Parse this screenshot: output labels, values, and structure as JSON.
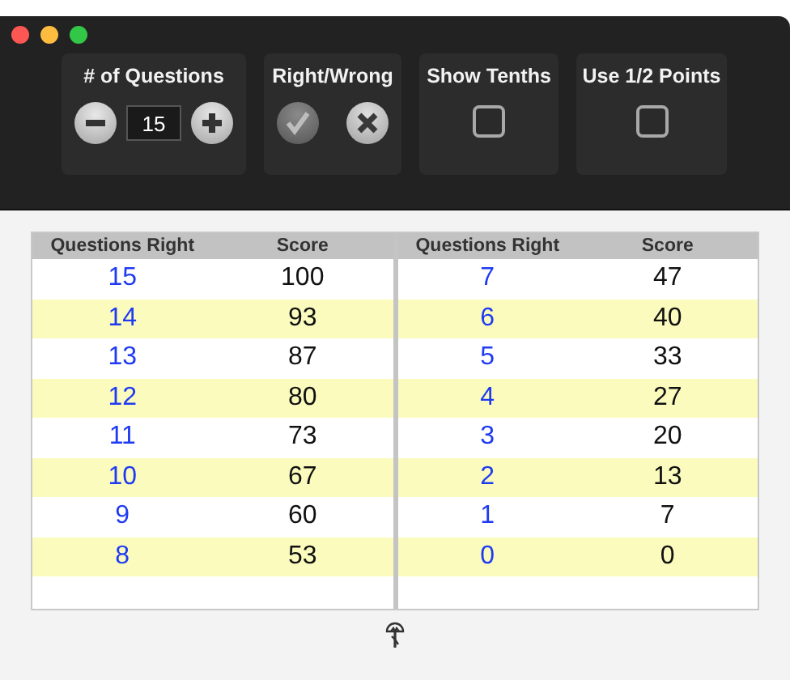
{
  "toolbar": {
    "question_count": {
      "label": "# of Questions",
      "value": "15"
    },
    "right_wrong": {
      "label": "Right/Wrong",
      "options": [
        {
          "kind": "right",
          "selected": true
        },
        {
          "kind": "wrong",
          "selected": false
        }
      ]
    },
    "show_tenths": {
      "label": "Show Tenths",
      "checked": false
    },
    "half_points": {
      "label": "Use 1/2 Points",
      "checked": false
    }
  },
  "tables": [
    {
      "columns": [
        "Questions Right",
        "Score"
      ],
      "rows": [
        [
          "15",
          "100"
        ],
        [
          "14",
          "93"
        ],
        [
          "13",
          "87"
        ],
        [
          "12",
          "80"
        ],
        [
          "11",
          "73"
        ],
        [
          "10",
          "67"
        ],
        [
          "9",
          "60"
        ],
        [
          "8",
          "53"
        ]
      ]
    },
    {
      "columns": [
        "Questions Right",
        "Score"
      ],
      "rows": [
        [
          "7",
          "47"
        ],
        [
          "6",
          "40"
        ],
        [
          "5",
          "33"
        ],
        [
          "4",
          "27"
        ],
        [
          "3",
          "20"
        ],
        [
          "2",
          "13"
        ],
        [
          "1",
          "7"
        ],
        [
          "0",
          "0"
        ]
      ]
    }
  ]
}
